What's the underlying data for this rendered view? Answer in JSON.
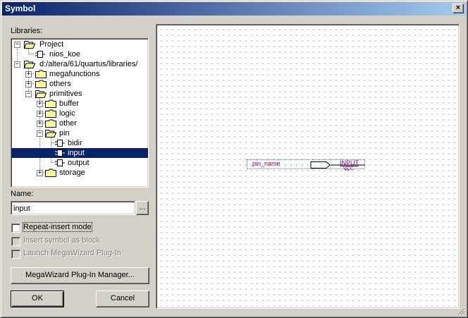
{
  "window": {
    "title": "Symbol",
    "close_label": "×"
  },
  "libraries": {
    "label": "Libraries:",
    "tree": [
      {
        "label": "Project"
      },
      {
        "label": "nios_koe"
      },
      {
        "label": "d:/altera/61/quartus/libraries/"
      },
      {
        "label": "megafunctions"
      },
      {
        "label": "others"
      },
      {
        "label": "primitives"
      },
      {
        "label": "buffer"
      },
      {
        "label": "logic"
      },
      {
        "label": "other"
      },
      {
        "label": "pin"
      },
      {
        "label": "bidir"
      },
      {
        "label": "input"
      },
      {
        "label": "output"
      },
      {
        "label": "storage"
      }
    ]
  },
  "name_field": {
    "label": "Name:",
    "value": "input",
    "browse_label": "..."
  },
  "options": {
    "repeat_insert": "Repeat-insert mode",
    "insert_block": "Insert symbol as block",
    "launch_megawizard": "Launch MegaWizard Plug-In"
  },
  "buttons": {
    "megawizard": "MegaWizard Plug-In Manager...",
    "ok": "OK",
    "cancel": "Cancel"
  },
  "preview": {
    "pin_name": "pin_name",
    "pin_type": "INPUT",
    "pin_vcc": "VCC"
  },
  "colors": {
    "title_bar": "#0a246a",
    "selection": "#0a246a",
    "pin_text": "#800080",
    "pin_box": "#4a86b4"
  }
}
